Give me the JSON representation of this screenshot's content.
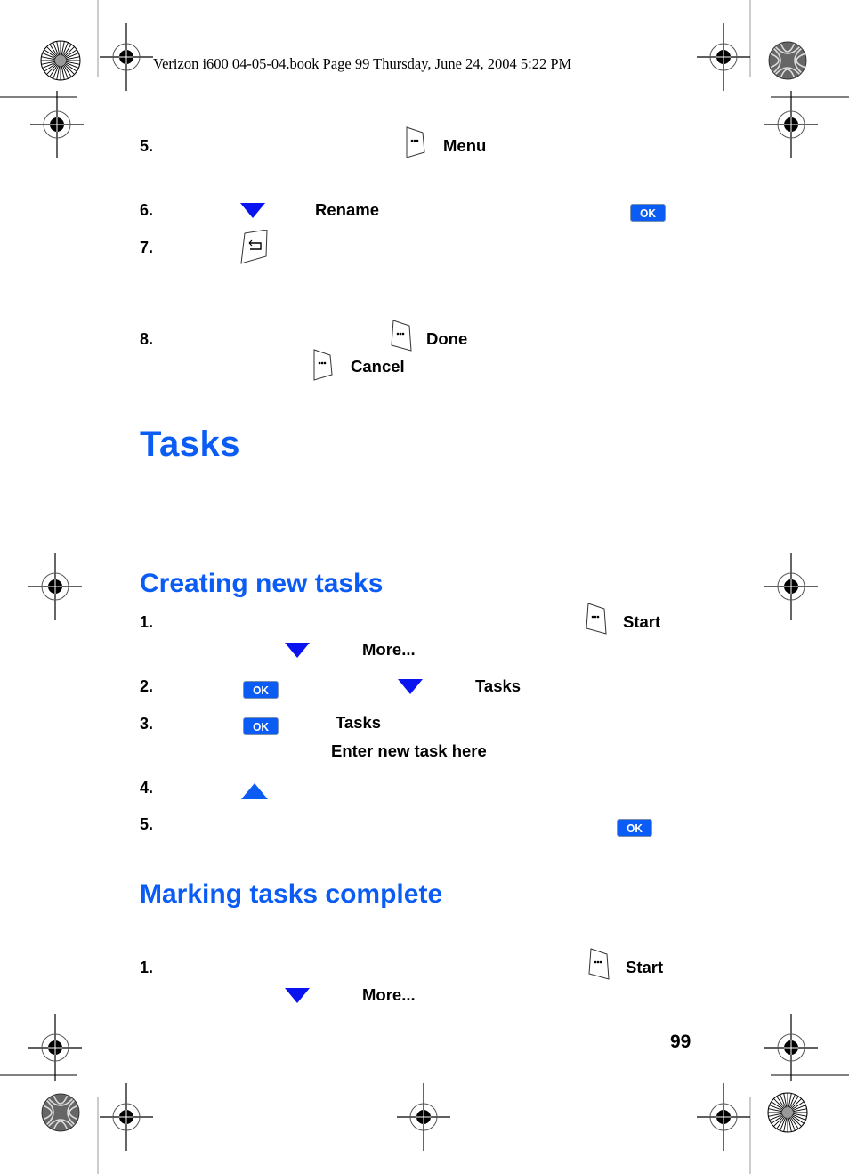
{
  "header": {
    "print_line": "Verizon i600 04-05-04.book  Page 99  Thursday, June 24, 2004  5:22 PM"
  },
  "top_steps": [
    {
      "num": "5.",
      "keyword": "Menu",
      "icon": "softkey-icon"
    },
    {
      "num": "6.",
      "keyword": "Rename",
      "icons": [
        "nav-down-icon",
        "ok-button-icon"
      ]
    },
    {
      "num": "7.",
      "icon": "back-key-icon"
    },
    {
      "num": "8.",
      "keyword": "Done",
      "secondary_keyword": "Cancel",
      "icons": [
        "softkey-icon",
        "softkey-icon"
      ]
    }
  ],
  "title": "Tasks",
  "sections": [
    {
      "heading": "Creating new tasks",
      "steps": [
        {
          "num": "1.",
          "keyword": "Start",
          "sub_keyword": "More..."
        },
        {
          "num": "2.",
          "keyword": "Tasks"
        },
        {
          "num": "3.",
          "keyword": "Tasks",
          "sub_keyword": "Enter new task here"
        },
        {
          "num": "4."
        },
        {
          "num": "5."
        }
      ]
    },
    {
      "heading": "Marking tasks complete",
      "steps": [
        {
          "num": "1.",
          "keyword": "Start",
          "sub_keyword": "More..."
        }
      ]
    }
  ],
  "ok_label": "OK",
  "page_number": "99",
  "colors": {
    "heading_blue": "#0a5cf5",
    "nav_arrow_blue": "#0a14f0",
    "ok_button_blue": "#0a5cf5"
  }
}
